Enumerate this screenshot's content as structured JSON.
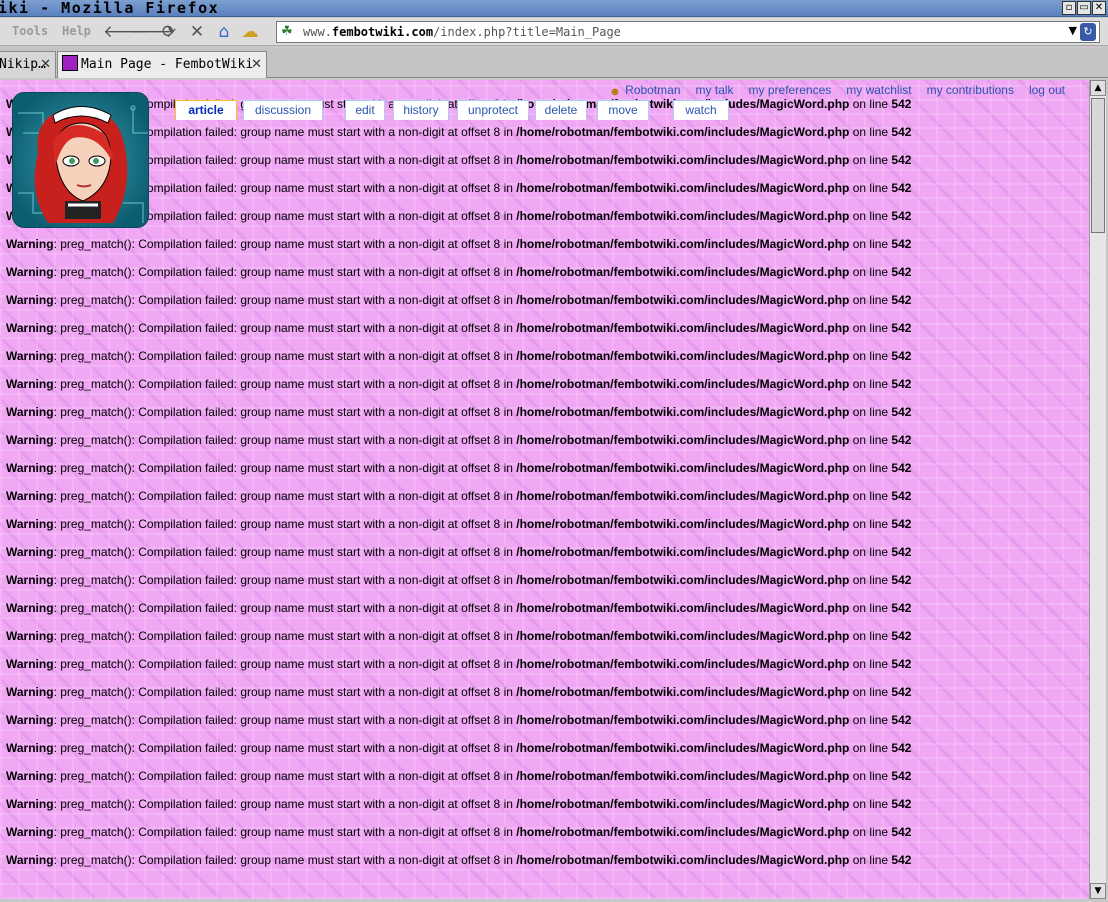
{
  "window": {
    "title": "iki - Mozilla Firefox",
    "buttons": [
      "▫",
      "▭",
      "✕"
    ]
  },
  "menu": [
    "Tools",
    "Help"
  ],
  "nav": {
    "back_icon": "back-arrow-icon",
    "forward_icon": "forward-arrow-icon",
    "reload_icon": "reload-icon",
    "stop_icon": "stop-icon",
    "home_icon": "home-icon",
    "weather_icon": "weather-icon"
  },
  "urlbar": {
    "url_prefix": "www.",
    "url_domain": "fembotwiki.com",
    "url_path": "/index.php?title=Main_Page"
  },
  "tabs": [
    {
      "label": "Nikip…",
      "active": false
    },
    {
      "label": "Main Page - FembotWiki",
      "active": true
    }
  ],
  "personal_tools": {
    "user": "Robotman",
    "links": [
      "my talk",
      "my preferences",
      "my watchlist",
      "my contributions",
      "log out"
    ]
  },
  "content_tabs": [
    "article",
    "discussion",
    "edit",
    "history",
    "unprotect",
    "delete",
    "move",
    "watch"
  ],
  "warning": {
    "label": "Warning",
    "message": ": preg_match(): Compilation failed: group name must start with a non-digit at offset 8 in ",
    "file": "/home/robotman/fembotwiki.com/includes/MagicWord.php",
    "on_line": " on line ",
    "line": "542",
    "count": 28
  },
  "colors": {
    "content_bg": "#f0a8f4",
    "link": "#2a55b0",
    "selected_tab_border": "#fabd23"
  }
}
